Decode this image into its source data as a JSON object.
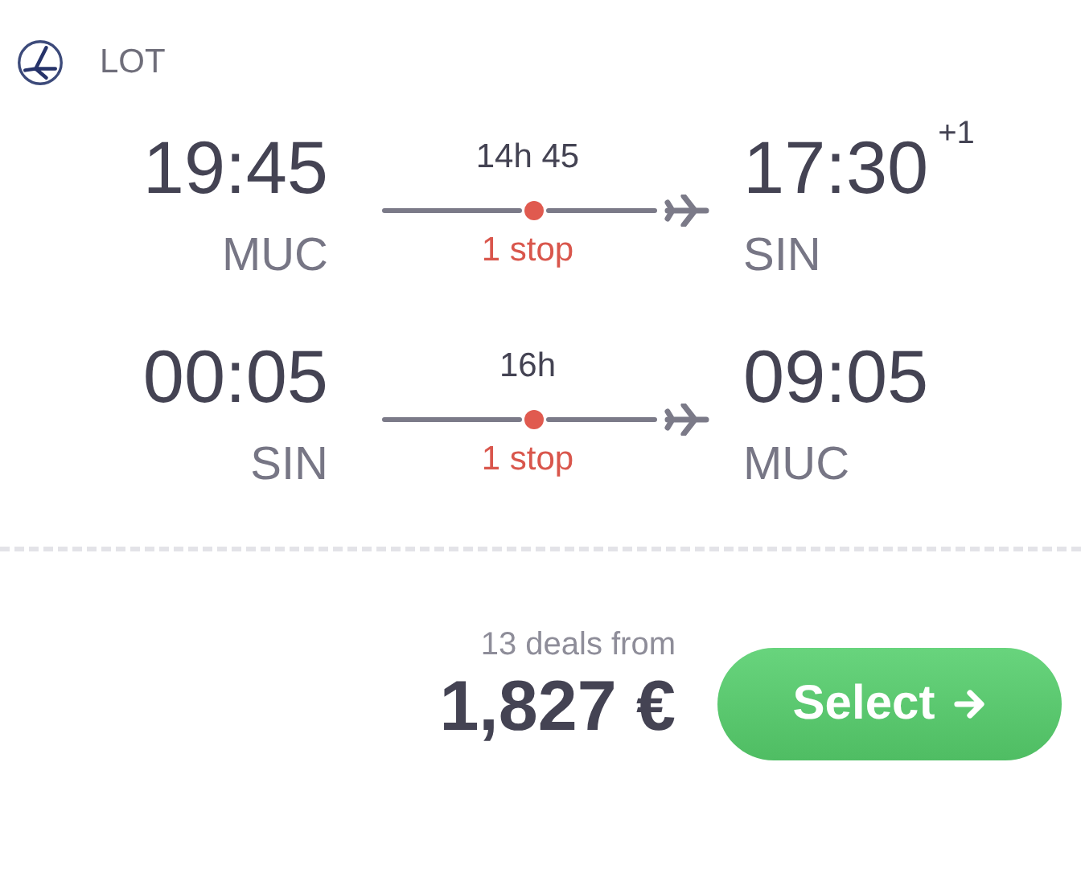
{
  "airline": {
    "name": "LOT"
  },
  "legs": [
    {
      "departure_time": "19:45",
      "departure_airport": "MUC",
      "duration": "14h 45",
      "stops": "1 stop",
      "arrival_time": "17:30",
      "day_offset": "+1",
      "arrival_airport": "SIN"
    },
    {
      "departure_time": "00:05",
      "departure_airport": "SIN",
      "duration": "16h",
      "stops": "1 stop",
      "arrival_time": "09:05",
      "arrival_airport": "MUC"
    }
  ],
  "deals": "13 deals from",
  "price": "1,827 €",
  "select_button": "Select"
}
